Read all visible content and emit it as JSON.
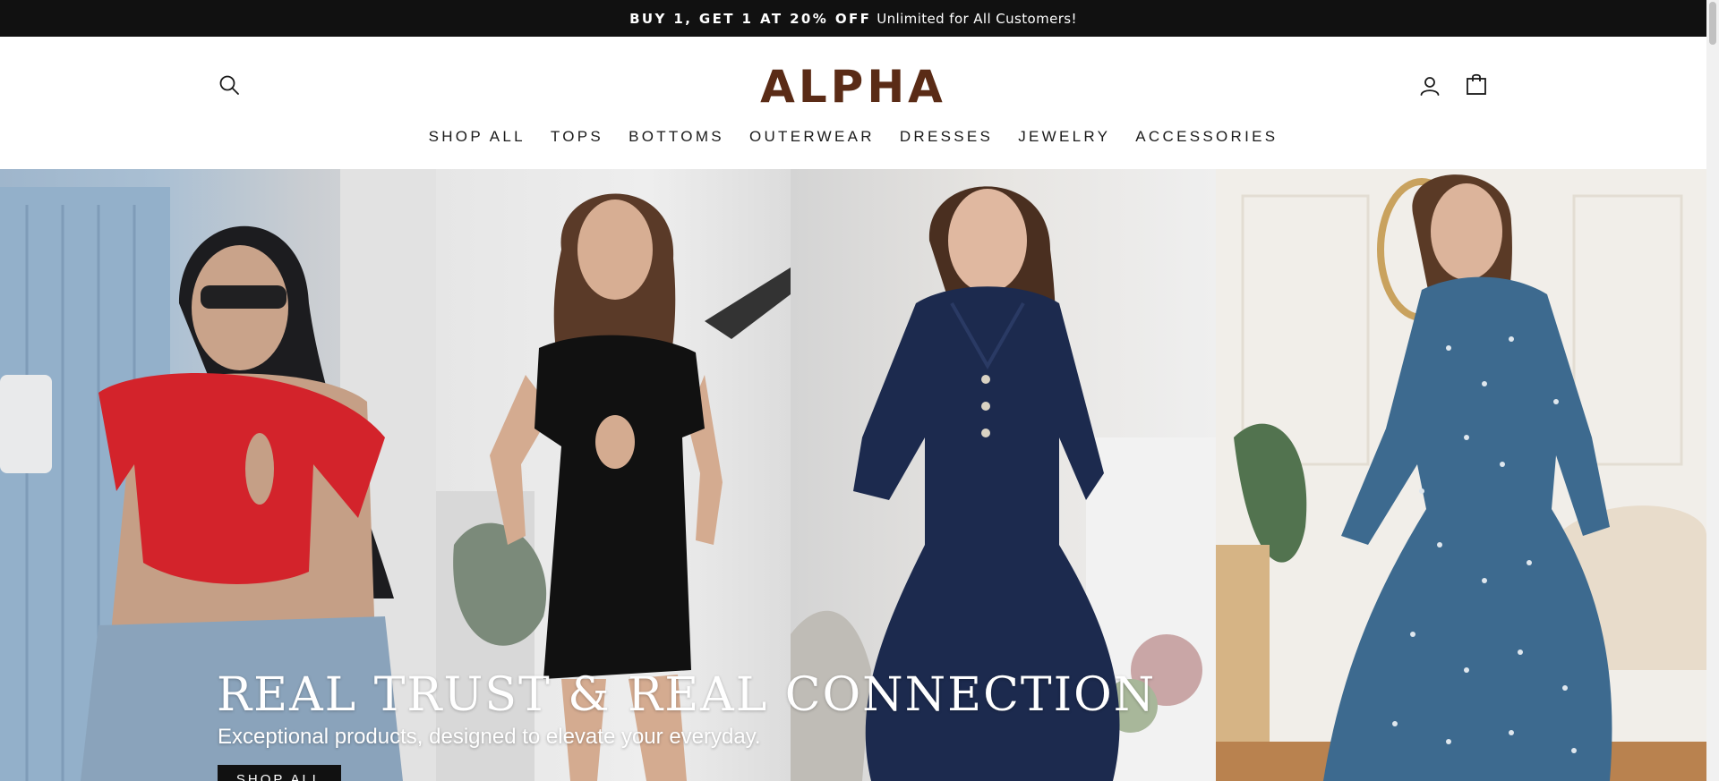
{
  "announcement": {
    "promo": "BUY 1, GET 1 AT 20% OFF",
    "message": "Unlimited for All Customers!"
  },
  "header": {
    "logo": "ALPHA",
    "icons": {
      "search": "search-icon",
      "account": "user-icon",
      "cart": "shopping-bag-icon"
    }
  },
  "nav": {
    "items": [
      "SHOP ALL",
      "TOPS",
      "BOTTOMS",
      "OUTERWEAR",
      "DRESSES",
      "JEWELRY",
      "ACCESSORIES"
    ]
  },
  "hero": {
    "title": "REAL TRUST & REAL CONNECTION",
    "subtitle": "Exceptional products, designed to elevate your everyday.",
    "cta": "SHOP ALL"
  },
  "colors": {
    "announcement_bg": "#111111",
    "logo": "#5a2b16",
    "button_bg": "#111111"
  }
}
